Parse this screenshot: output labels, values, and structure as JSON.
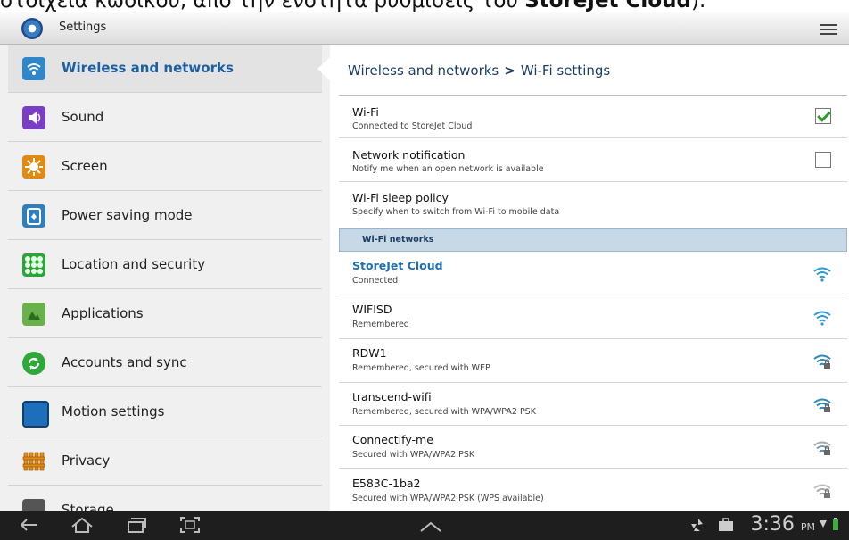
{
  "caption": {
    "pre": "στοιχεία κωδικού, από την ενότητα ρυθμίσεις του ",
    "bold": "StoreJet Cloud",
    "post": ")."
  },
  "window": {
    "title": "Settings"
  },
  "sidebar": {
    "items": [
      {
        "label": "Wireless and networks",
        "icon": "wifi-icon",
        "active": true
      },
      {
        "label": "Sound",
        "icon": "sound-icon"
      },
      {
        "label": "Screen",
        "icon": "screen-icon"
      },
      {
        "label": "Power saving mode",
        "icon": "power-saving-icon"
      },
      {
        "label": "Location and security",
        "icon": "location-security-icon"
      },
      {
        "label": "Applications",
        "icon": "applications-icon"
      },
      {
        "label": "Accounts and sync",
        "icon": "sync-icon"
      },
      {
        "label": "Motion settings",
        "icon": "motion-icon"
      },
      {
        "label": "Privacy",
        "icon": "privacy-icon"
      },
      {
        "label": "Storage",
        "icon": "storage-icon"
      }
    ]
  },
  "breadcrumb": {
    "parent": "Wireless and networks",
    "separator": ">",
    "current": "Wi-Fi settings"
  },
  "settings": [
    {
      "title": "Wi-Fi",
      "summary": "Connected to StoreJet Cloud",
      "checked": true
    },
    {
      "title": "Network notification",
      "summary": "Notify me when an open network is available",
      "checked": false
    },
    {
      "title": "Wi-Fi sleep policy",
      "summary": "Specify when to switch from Wi-Fi to mobile data"
    }
  ],
  "networks_header": "Wi-Fi networks",
  "networks": [
    {
      "name": "StoreJet Cloud",
      "status": "Connected",
      "secured": false
    },
    {
      "name": "WIFISD",
      "status": "Remembered",
      "secured": false
    },
    {
      "name": "RDW1",
      "status": "Remembered, secured with WEP",
      "secured": true
    },
    {
      "name": "transcend-wifi",
      "status": "Remembered, secured with WPA/WPA2 PSK",
      "secured": true
    },
    {
      "name": "Connectify-me",
      "status": "Secured with WPA/WPA2 PSK",
      "secured": true
    },
    {
      "name": "E583C-1ba2",
      "status": "Secured with WPA/WPA2 PSK (WPS available)",
      "secured": true
    }
  ],
  "statusbar": {
    "time": "3:36",
    "ampm": "PM"
  },
  "colors": {
    "accent": "#1f6fb5",
    "section_bg": "#c7d8e6",
    "sidebar_bg": "#f0f0f0"
  }
}
